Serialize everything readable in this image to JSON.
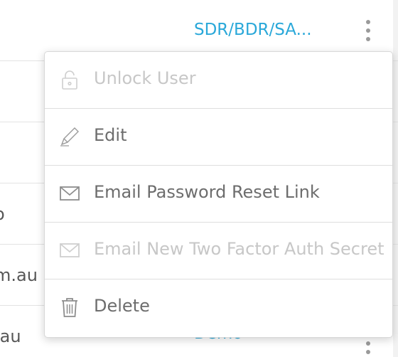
{
  "table": {
    "rows": [
      {
        "left_text": "",
        "role": "SDR/BDR/SA..."
      },
      {
        "left_text": "",
        "role": ""
      },
      {
        "left_text": "",
        "role": ""
      },
      {
        "left_text": "o",
        "role": ""
      },
      {
        "left_text": "m.au",
        "role": ""
      },
      {
        "left_text": ".au",
        "role": "Demo"
      }
    ]
  },
  "menu": {
    "items": [
      {
        "label": "Unlock User",
        "icon": "unlock-icon",
        "disabled": true
      },
      {
        "label": "Edit",
        "icon": "pencil-icon",
        "disabled": false
      },
      {
        "label": "Email Password Reset Link",
        "icon": "envelope-icon",
        "disabled": false
      },
      {
        "label": "Email New Two Factor Auth Secret",
        "icon": "envelope-icon",
        "disabled": true
      },
      {
        "label": "Delete",
        "icon": "trash-icon",
        "disabled": false
      }
    ]
  },
  "colors": {
    "link": "#2aa8d9",
    "text": "#6d6d6d",
    "disabled": "#c7c7c7"
  }
}
